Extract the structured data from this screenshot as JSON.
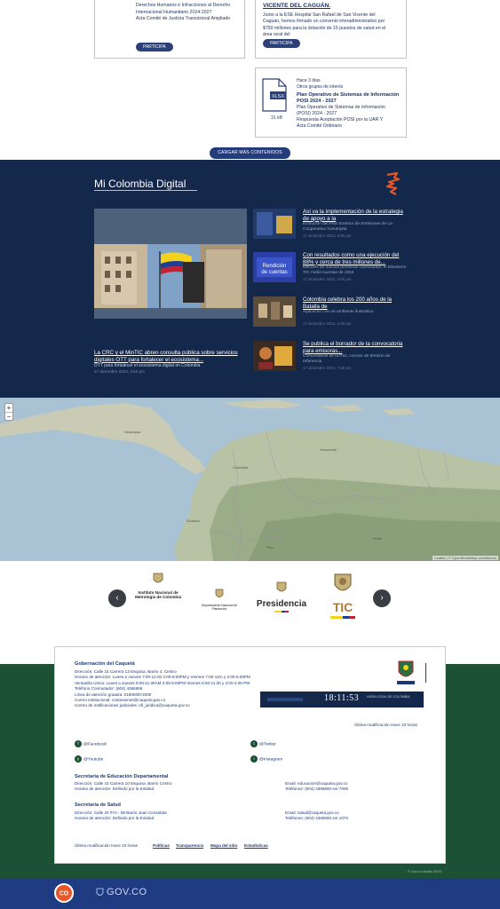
{
  "top_cards": {
    "left_card_lines": [
      "Derechos Humanos e Infracciones al Derecho",
      "Internacional Humanitario 2024-2027",
      "Acta Comité de Justicia Transicional Ampliado"
    ],
    "left_button": "PARTICIPA",
    "right_card_heading": "VICENTE DEL CAGUÁN.",
    "right_card_lines": [
      "Junto a la ESE Hospital San Rafael de San Vicente del",
      "Caguán, hemos firmado un convenio interadministrativo por",
      "$750 millones para la dotación de 15 puestos de salud en el",
      "área rural del"
    ],
    "right_button": "PARTICIPA",
    "doc_card": {
      "meta_line1": "Hace 3 días",
      "meta_line2": "Otros grupos de interés",
      "title": "Plan Operativo de Sistemas de Información POSI 2024 - 2027",
      "lines": [
        "Plan Operativo de Sistemas de Información",
        "(POSI) 2024 - 2027",
        "Respuesta Aceptación POSI por la UAR Y",
        "Acta Comité Ordinario"
      ],
      "file_type": "XLSX",
      "file_size": "31 kB"
    },
    "load_more": "CARGAR MÁS CONTENIDOS"
  },
  "mcd": {
    "title": "Mi Colombia Digital",
    "featured": {
      "title": "La CRC y el MinTIC abren consulta pública sobre servicios digitales OTT para fortalecer el ecosistema...",
      "subtitle": "OTT para fortalecer el ecosistema digital en Colombia",
      "date": "17 diciembre 2024, 4:50 pm"
    },
    "news": [
      {
        "title": "Así va la implementación de la estrategia de apoyo a la",
        "subtitle": "Evolución del Plan Exterior de Emisiones de La Cooperativa Tumaripita",
        "date": "17 diciembre 2024, 9:00 pm"
      },
      {
        "title": "Con resultados como una ejecución del 88% y cerca de tres millones de...",
        "subtitle": "Millones de nuevas personas conectadas, el Ministerio TIC rindió cuentas de 2024",
        "date": "17 diciembre 2024, 3:00 pm"
      },
      {
        "title": "Colombia celebra los 200 años de la Batalla de",
        "subtitle": "Ayacucho con un ambiente ilustrativo",
        "date": "17 diciembre 2024, 3:00 pm"
      },
      {
        "title": "Se publica el borrador de la convocatoria para emisoras...",
        "subtitle": "Comunitarias de la Paz, conoce de término de referencia",
        "date": "17 diciembre 2024, 7:38 pm"
      }
    ]
  },
  "map": {
    "zoom_in": "+",
    "zoom_out": "−",
    "attribution": "Leaflet | © OpenStreetMap contributors"
  },
  "partners": {
    "prev": "‹",
    "next": "›",
    "logos": [
      {
        "name": "Instituto Nacional de Metrología de Colombia"
      },
      {
        "name": "Departamento Nacional de Planeación"
      },
      {
        "name": "Presidencia"
      },
      {
        "name": "TIC"
      }
    ]
  },
  "footer": {
    "org_title": "Gobernación del Caquetá",
    "org_lines": [
      "Dirección: Calle 15 Carrera 13 Esquina, Barrio 4, Centro",
      "Horario de atención: Lunes a Jueves 7:00-12:00 2:00-6:00PM y Viernes 7:00-12m y 2:00-5:00PM",
      "Ventanilla Única: Lunes a Jueves 8:00-11:30AM 2:00-5:00PM Viernes 8:00-11:30 y 2:00-4:00 PM",
      "Teléfono Conmutador: (604) 4366666",
      "Línea de atención gratuita: 018000972000",
      "Correo institucional: contactenos@caqueta.gov.co",
      "Correo de notificaciones judiciales: ofi_juridica@caqueta.gov.co"
    ],
    "clock_time": "18:11:53",
    "clock_label": "HORA LEGAL DE COLOMBIA",
    "updated": "Última modificación Hace 10 horas",
    "social": [
      {
        "label": "@Facebook",
        "icon": "f"
      },
      {
        "label": "@Twitter",
        "icon": "t"
      },
      {
        "label": "@Youtube",
        "icon": "y"
      },
      {
        "label": "@Instagram",
        "icon": "i"
      }
    ],
    "educacion_title": "Secretaría de Educación Departamental",
    "educacion_lines": [
      "Dirección: Calle 15 Carrera 10 Esquina, Barrio Centro",
      "Horario de atención: Definido por la Entidad"
    ],
    "educacion_contact": [
      "Email: educacion@caqueta.gov.co",
      "Teléfonos: (604) 4366660 ext 7005"
    ],
    "salud_title": "Secretaría de Salud",
    "salud_lines": [
      "Dirección: Calle 20 #7A - 08 Barrio Juan Consolata",
      "Horario de atención: Definido por la Entidad"
    ],
    "salud_contact": [
      "Email: salud@caqueta.gov.co",
      "Teléfonos: (604) 4366660 ext 1070"
    ],
    "bottom_updated": "Última modificación Hace 10 horas",
    "links": [
      "Políticas",
      "Transparencia",
      "Mapa del sitio",
      "Estadísticas"
    ],
    "copyright": "© Gov.co Mintic 2024"
  },
  "govbar": {
    "text": "GOV.CO",
    "co_text": "CO"
  }
}
